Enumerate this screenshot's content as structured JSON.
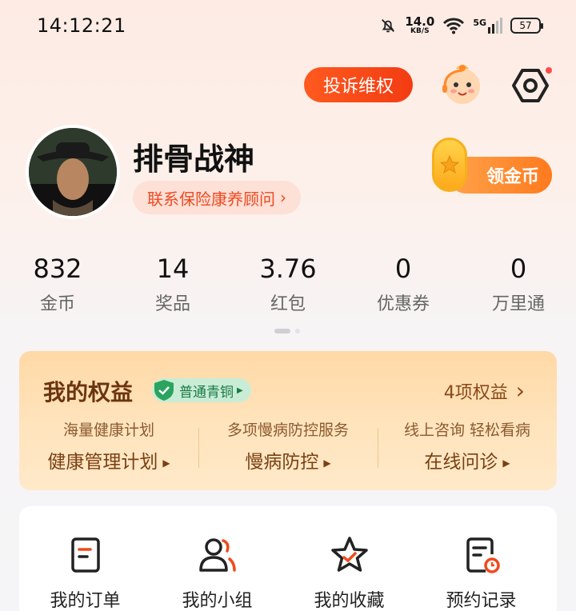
{
  "status_bar": {
    "time": "14:12:21",
    "net_speed": "14.0",
    "net_unit": "KB/S",
    "network": "5G",
    "battery": "57"
  },
  "header": {
    "complaint_button": "投诉维权",
    "mascot_icon": "mascot-icon",
    "settings_icon": "gear-icon"
  },
  "profile": {
    "username": "排骨战神",
    "advisor_link": "联系保险康养顾问",
    "coin_button": "领金币"
  },
  "stats": [
    {
      "value": "832",
      "label": "金币"
    },
    {
      "value": "14",
      "label": "奖品"
    },
    {
      "value": "3.76",
      "label": "红包"
    },
    {
      "value": "0",
      "label": "优惠券"
    },
    {
      "value": "0",
      "label": "万里通"
    }
  ],
  "benefits": {
    "title": "我的权益",
    "level": "普通青铜",
    "count": "4项权益",
    "items": [
      {
        "subtitle": "海量健康计划",
        "title": "健康管理计划"
      },
      {
        "subtitle": "多项慢病防控服务",
        "title": "慢病防控"
      },
      {
        "subtitle": "线上咨询 轻松看病",
        "title": "在线问诊"
      }
    ]
  },
  "menu": [
    {
      "label": "我的订单",
      "icon": "order-icon"
    },
    {
      "label": "我的小组",
      "icon": "group-icon"
    },
    {
      "label": "我的收藏",
      "icon": "star-icon"
    },
    {
      "label": "预约记录",
      "icon": "appointment-icon"
    }
  ],
  "colors": {
    "accent": "#f2431a",
    "benefit_text": "#6b3410",
    "coin": "#ff8a2a"
  }
}
